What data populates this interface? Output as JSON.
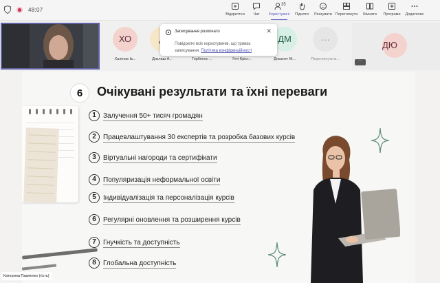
{
  "toolbar": {
    "timer": "48:07",
    "buttons": [
      {
        "label": "Відкриттєи",
        "icon": "open-icon"
      },
      {
        "label": "Чат",
        "icon": "chat-icon"
      },
      {
        "label": "Користувачі",
        "icon": "people-icon",
        "count": "35",
        "active": true
      },
      {
        "label": "Підняти",
        "icon": "raise-hand-icon"
      },
      {
        "label": "Реагувати",
        "icon": "react-icon"
      },
      {
        "label": "Переглянути",
        "icon": "view-icon"
      },
      {
        "label": "Кімнати",
        "icon": "rooms-icon"
      },
      {
        "label": "Програми",
        "icon": "apps-icon"
      },
      {
        "label": "Додатково",
        "icon": "more-icon"
      }
    ]
  },
  "participants": [
    {
      "initials": "ХО",
      "name": "Халілов Ів...",
      "color": "#f4d3ce"
    },
    {
      "initials": "Д",
      "name": "Диклаш А...",
      "color": "#f6e7c8"
    },
    {
      "initials": "",
      "name": "Горбенос ...",
      "color": "#ececec"
    },
    {
      "initials": "",
      "name": "Геті Кріст...",
      "color": "#ececec"
    },
    {
      "initials": "ДМ",
      "name": "Докалет М...",
      "color": "#d7efe4"
    },
    {
      "initials": "···",
      "name": "Переглянути в...",
      "color": "#e6e6e6"
    }
  ],
  "notice": {
    "title": "Записування розпочато",
    "body": "Повідомте всіх користувачів, що триває записування.",
    "link": "Політика конфіденційності"
  },
  "spotlight": {
    "initials": "ДЮ"
  },
  "more_button": "···",
  "slide": {
    "section_number": "6",
    "title": "Очікувані результати та їхні переваги",
    "items": [
      {
        "num": "1",
        "text": "Залучення 50+ тисяч громадян"
      },
      {
        "num": "2",
        "text": "Працевлаштування 30 експертів та розробка базових курсів"
      },
      {
        "num": "3",
        "text": "Віртуальні нагороди та сертифікати"
      },
      {
        "num": "4",
        "text": "Популяризація неформальної освіти"
      },
      {
        "num": "5",
        "text": "Індивідуалізація та персоналізація курсів"
      },
      {
        "num": "6",
        "text": "Регулярні оновлення та розширення курсів"
      },
      {
        "num": "7",
        "text": "Гнучкість та доступність"
      },
      {
        "num": "8",
        "text": "Глобальна доступність"
      }
    ]
  },
  "presenter_name": "Катерина Павленко (гість)"
}
